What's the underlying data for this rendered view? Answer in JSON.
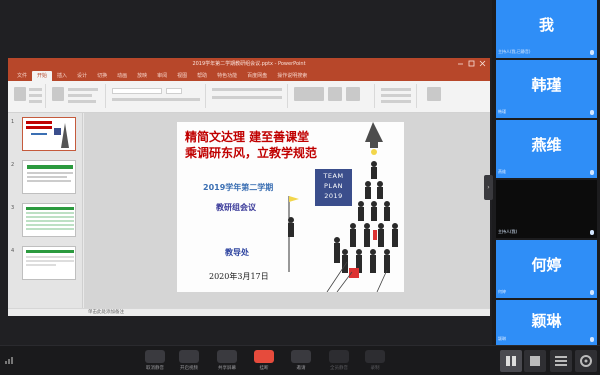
{
  "ppt": {
    "window_title": "2019学年第二学期教研组会议.pptx - PowerPoint",
    "tabs": [
      "文件",
      "开始",
      "插入",
      "设计",
      "切换",
      "动画",
      "放映",
      "审阅",
      "视图",
      "帮助",
      "特色功能",
      "百度网盘",
      "操作说明搜索"
    ],
    "active_tab": "开始",
    "status_text": "单击此处添加备注"
  },
  "slide": {
    "poem_line1": "精简文达理  建至善课堂",
    "poem_line2": "乘调研东风，立教学规范",
    "term": "2019学年第二学期",
    "meeting": "教研组会议",
    "team": "TEAM",
    "plan": "PLAN",
    "year": "2019",
    "office": "教导处",
    "date": "2020年3月17日"
  },
  "thumb_numbers": [
    "1",
    "2",
    "3",
    "4"
  ],
  "participants": [
    {
      "name": "我",
      "sub": "主持人(我,已静音)"
    },
    {
      "name": "韩瑾",
      "sub": "韩瑾"
    },
    {
      "name": "燕维",
      "sub": "燕维"
    },
    {
      "name": "",
      "sub": "主持人(我)"
    },
    {
      "name": "何婷",
      "sub": "何婷"
    },
    {
      "name": "颖琳",
      "sub": "颖琳"
    }
  ],
  "toolbar": {
    "buttons": [
      "取消静音",
      "开启视频",
      "共享屏幕",
      "挂断",
      "邀请",
      "全员静音",
      "录制"
    ]
  },
  "colors": {
    "tile_blue": "#2f8ef7",
    "ppt_red": "#b7472a",
    "hangup_red": "#e64b3c"
  }
}
